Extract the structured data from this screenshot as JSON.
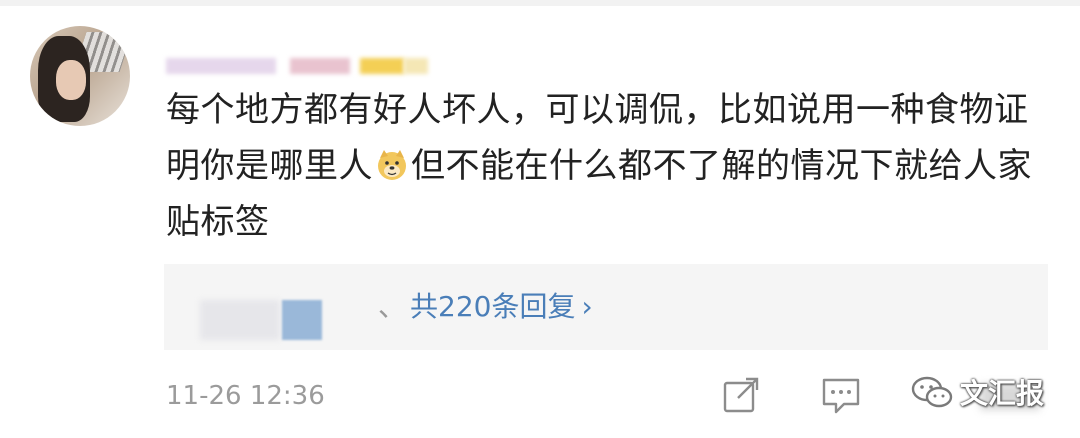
{
  "comment": {
    "text": "每个地方都有好人坏人，可以调侃，比如说用一种食物证明你是哪里人",
    "text_after_emoji": "但不能在什么都不了解的情况下就给人家贴标签",
    "emoji_icon": "doge-emoji-icon"
  },
  "replies": {
    "separator": "、",
    "label": "共220条回复",
    "chevron": "›"
  },
  "meta": {
    "timestamp": "11-26 12:36"
  },
  "actions": {
    "share_icon": "share-icon",
    "comment_icon": "comment-icon",
    "like_icon": "like-icon"
  },
  "watermark": {
    "text": "文汇报",
    "icon": "wechat-icon"
  },
  "colors": {
    "text": "#222222",
    "link": "#4a7eb8",
    "muted": "#9b9b9b",
    "reply_bg": "#f5f5f5"
  }
}
